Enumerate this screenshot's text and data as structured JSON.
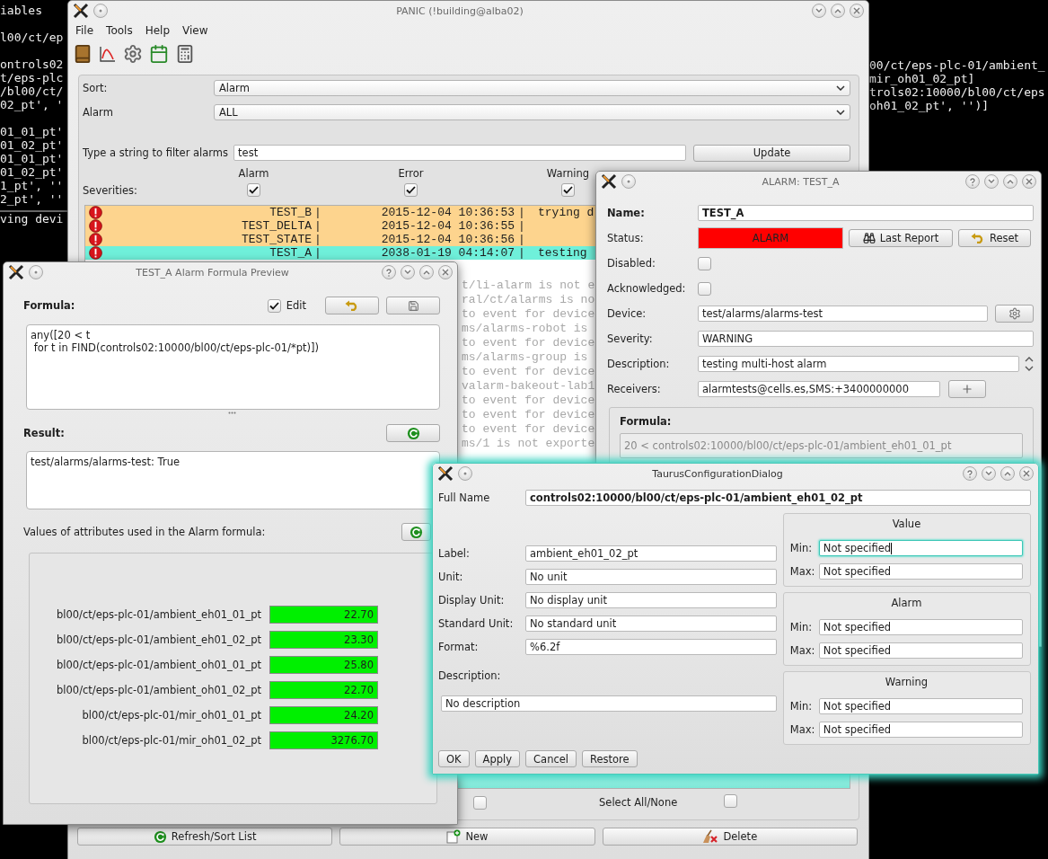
{
  "terminal": {
    "upper_blocks": [
      [
        "iables"
      ],
      [
        "l00/ct/ep"
      ],
      [
        "ontrols02",
        "t/eps-plc",
        "/bl00/ct/",
        "02_pt', '"
      ],
      [
        "01_01_pt'",
        "01_02_pt'",
        "01_01_pt'",
        "01_02_pt'",
        "1_pt', ''",
        "2_pt', ''"
      ]
    ],
    "lower_lines": [
      "ving devi"
    ],
    "right_lines": [
      "00/ct/eps-plc-01/ambient_",
      "mir_oh01_02_pt]",
      "trols02:10000/bl00/ct/eps",
      "oh01_02_pt', '')]"
    ]
  },
  "panic_window": {
    "title": "PANIC (!building@alba02)",
    "active": false,
    "menu": [
      "File",
      "Tools",
      "Help",
      "View"
    ],
    "sort": {
      "label": "Sort:",
      "value": "Alarm"
    },
    "alarm_select": {
      "label": "Alarm",
      "value": "ALL"
    },
    "filter": {
      "label": "Type a string to filter alarms",
      "value": "test"
    },
    "update_button": "Update",
    "severities": {
      "label": "Severities:",
      "items": [
        {
          "label": "Alarm",
          "checked": true
        },
        {
          "label": "Error",
          "checked": true
        },
        {
          "label": "Warning",
          "checked": true
        }
      ]
    },
    "alarms": {
      "separator": "|",
      "rows": [
        {
          "name": "TEST_B",
          "time": "2015-12-04 10:36:53",
          "description": "trying d",
          "color": "#fdd48e"
        },
        {
          "name": "TEST_DELTA",
          "time": "2015-12-04 10:36:55",
          "color": "#fdd48e"
        },
        {
          "name": "TEST_STATE",
          "time": "2015-12-04 10:36:56",
          "color": "#fdd48e"
        },
        {
          "name": "TEST_A",
          "time": "2038-01-19 04:14:07",
          "description": "testing",
          "color": "#6ff0da"
        }
      ]
    },
    "log_lines": [
      "t/li-alarm is not e",
      "ral/ct/alarms is no",
      "to event for device",
      "ms/alarms-robot is",
      "to event for device",
      "ms/alarms-group is",
      "to event for device",
      "valarm-bakeout-lab1",
      "to event for device",
      "to event for device",
      "to event for device",
      "ms/1 is not exporte"
    ],
    "select_all": {
      "label": "Select All/None",
      "left_checked": false,
      "right_checked": false
    },
    "buttons": [
      {
        "kind": "refresh",
        "label": "Refresh/Sort List"
      },
      {
        "kind": "new",
        "label": "New"
      },
      {
        "kind": "delete",
        "label": "Delete"
      }
    ]
  },
  "formula_preview": {
    "title": "TEST_A Alarm Formula Preview",
    "active": false,
    "formula_label": "Formula:",
    "edit": {
      "label": "Edit",
      "checked": true
    },
    "formula_lines": [
      "any([20 < t",
      " for t in FIND(controls02:10000/bl00/ct/eps-plc-01/*pt)])"
    ],
    "result_label": "Result:",
    "result": "test/alarms/alarms-test: True",
    "values_label": "Values of attributes used in the Alarm formula:",
    "values": [
      {
        "attribute": "bl00/ct/eps-plc-01/ambient_eh01_01_pt",
        "value": "22.70"
      },
      {
        "attribute": "bl00/ct/eps-plc-01/ambient_eh01_02_pt",
        "value": "23.30"
      },
      {
        "attribute": "bl00/ct/eps-plc-01/ambient_oh01_01_pt",
        "value": "25.80"
      },
      {
        "attribute": "bl00/ct/eps-plc-01/ambient_oh01_02_pt",
        "value": "22.70"
      },
      {
        "attribute": "bl00/ct/eps-plc-01/mir_oh01_01_pt",
        "value": "24.20"
      },
      {
        "attribute": "bl00/ct/eps-plc-01/mir_oh01_02_pt",
        "value": "3276.70"
      }
    ]
  },
  "alarm_window": {
    "title": "ALARM: TEST_A",
    "active": false,
    "name": {
      "label": "Name:",
      "value": "TEST_A"
    },
    "status": {
      "label": "Status:",
      "value": "ALARM",
      "alarm_active": true
    },
    "last_report_button": "Last Report",
    "reset_button": "Reset",
    "disabled": {
      "label": "Disabled:",
      "checked": false
    },
    "acknowledged": {
      "label": "Acknowledged:",
      "checked": false
    },
    "device": {
      "label": "Device:",
      "value": "test/alarms/alarms-test"
    },
    "severity": {
      "label": "Severity:",
      "value": "WARNING"
    },
    "description": {
      "label": "Description:",
      "value": "testing multi-host alarm"
    },
    "receivers": {
      "label": "Receivers:",
      "value": "alarmtests@cells.es,SMS:+3400000000"
    },
    "formula": {
      "label": "Formula:",
      "value": "20 < controls02:10000/bl00/ct/eps-plc-01/ambient_eh01_01_pt"
    }
  },
  "taurus_dialog": {
    "title": "TaurusConfigurationDialog",
    "active": true,
    "full_name": {
      "label": "Full Name",
      "value": "controls02:10000/bl00/ct/eps-plc-01/ambient_eh01_02_pt"
    },
    "fields": [
      {
        "label": "Label:",
        "value": "ambient_eh01_02_pt"
      },
      {
        "label": "Unit:",
        "value": "No unit"
      },
      {
        "label": "Display Unit:",
        "value": "No display unit"
      },
      {
        "label": "Standard Unit:",
        "value": "No standard unit"
      },
      {
        "label": "Format:",
        "value": "%6.2f"
      }
    ],
    "description": {
      "label": "Description:",
      "value": "No description"
    },
    "buttons": [
      "OK",
      "Apply",
      "Cancel",
      "Restore"
    ],
    "ranges": [
      {
        "title": "Value",
        "min": {
          "label": "Min:",
          "value": "Not specified",
          "focused": true
        },
        "max": {
          "label": "Max:",
          "value": "Not specified",
          "focused": false
        }
      },
      {
        "title": "Alarm",
        "min": {
          "label": "Min:",
          "value": "Not specified",
          "focused": false
        },
        "max": {
          "label": "Max:",
          "value": "Not specified",
          "focused": false
        }
      },
      {
        "title": "Warning",
        "min": {
          "label": "Min:",
          "value": "Not specified",
          "focused": false
        },
        "max": {
          "label": "Max:",
          "value": "Not specified",
          "focused": false
        }
      }
    ]
  }
}
